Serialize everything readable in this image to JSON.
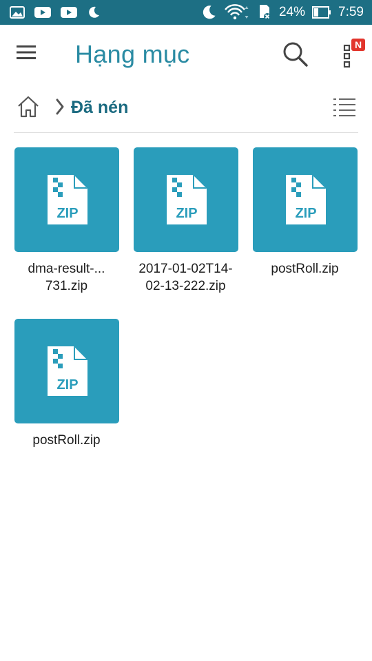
{
  "status_bar": {
    "battery": "24%",
    "time": "7:59"
  },
  "app_bar": {
    "title": "Hạng mục",
    "badge": "N"
  },
  "breadcrumb": {
    "current": "Đã nén"
  },
  "files": [
    {
      "name": "dma-result-...\n731.zip",
      "type_label": "ZIP"
    },
    {
      "name": "2017-01-02T14-\n02-13-222.zip",
      "type_label": "ZIP"
    },
    {
      "name": "postRoll.zip",
      "type_label": "ZIP"
    },
    {
      "name": "postRoll.zip",
      "type_label": "ZIP"
    }
  ],
  "colors": {
    "status_bar": "#1d6f84",
    "accent": "#2a8ba3",
    "tile": "#2a9dbb",
    "badge": "#e2352c"
  },
  "icons": {
    "menu": "hamburger-icon",
    "search": "search-icon",
    "more": "overflow-menu-icon",
    "home": "home-icon",
    "view": "list-view-icon",
    "file": "zip-file-icon"
  }
}
